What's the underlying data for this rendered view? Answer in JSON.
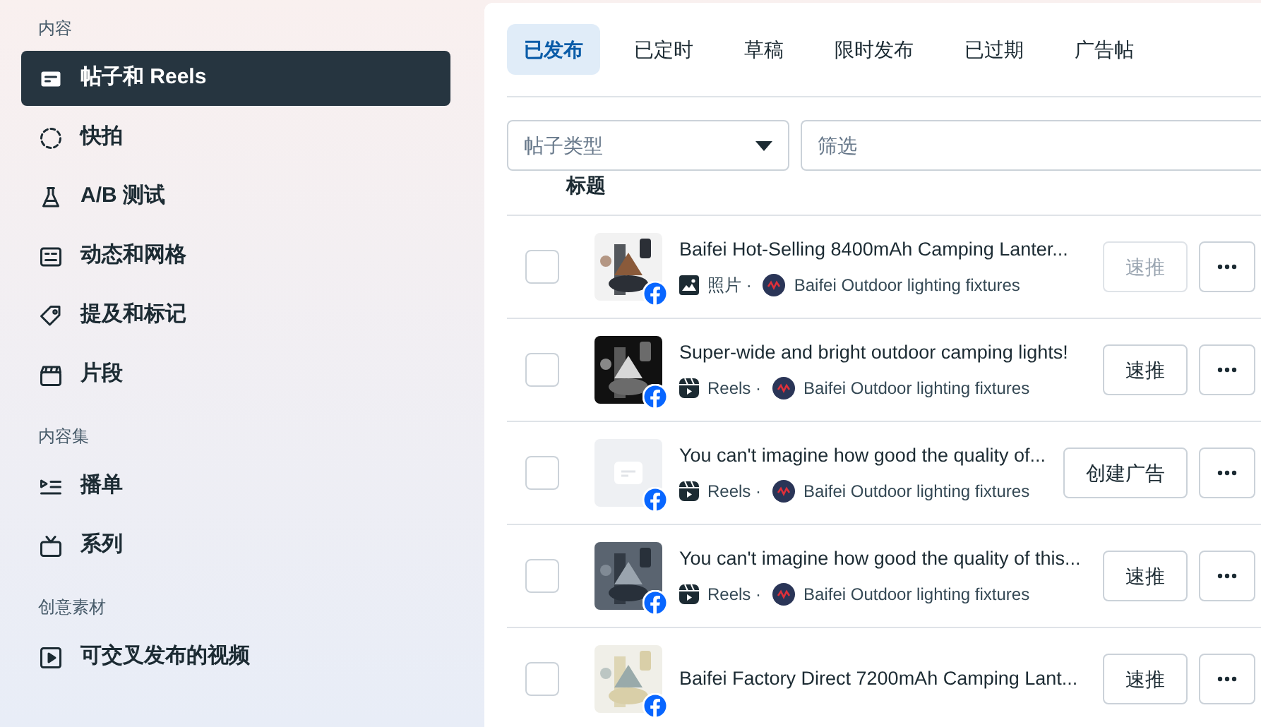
{
  "sidebar": {
    "sections": [
      {
        "title": "内容",
        "items": [
          {
            "label": "帖子和 Reels",
            "selected": true
          },
          {
            "label": "快拍",
            "selected": false
          },
          {
            "label": "A/B 测试",
            "selected": false
          },
          {
            "label": "动态和网格",
            "selected": false
          },
          {
            "label": "提及和标记",
            "selected": false
          },
          {
            "label": "片段",
            "selected": false
          }
        ]
      },
      {
        "title": "内容集",
        "items": [
          {
            "label": "播单",
            "selected": false
          },
          {
            "label": "系列",
            "selected": false
          }
        ]
      },
      {
        "title": "创意素材",
        "items": [
          {
            "label": "可交叉发布的视频",
            "selected": false
          }
        ]
      }
    ]
  },
  "tabs": [
    {
      "label": "已发布",
      "selected": true
    },
    {
      "label": "已定时",
      "selected": false
    },
    {
      "label": "草稿",
      "selected": false
    },
    {
      "label": "限时发布",
      "selected": false
    },
    {
      "label": "已过期",
      "selected": false
    },
    {
      "label": "广告帖",
      "selected": false
    }
  ],
  "filters": {
    "post_type": {
      "placeholder": "帖子类型"
    },
    "search": {
      "placeholder": "筛选"
    }
  },
  "table": {
    "columns": [
      "标题"
    ],
    "rows": [
      {
        "title": "Baifei Hot-Selling 8400mAh Camping Lanter...",
        "checked": false,
        "type": "照片 ·",
        "page": "Baifei Outdoor lighting fixtures",
        "action": "速推",
        "disabled": true
      },
      {
        "title": "Super-wide and bright outdoor camping lights!",
        "checked": false,
        "kind": "reels",
        "type": "Reels ·",
        "page": "Baifei Outdoor lighting fixtures",
        "action": "速推",
        "disabled": false
      },
      {
        "title": "You can't imagine how good the quality of...",
        "checked": false,
        "thumbnail": {
          "kind": "placeholder"
        },
        "kind": "reels",
        "type": "Reels ·",
        "page": "Baifei Outdoor lighting fixtures",
        "action": "创建广告",
        "disabled": false
      },
      {
        "title": "You can't imagine how good the quality of this...",
        "checked": false,
        "kind": "reels",
        "type": "Reels ·",
        "page": "Baifei Outdoor lighting fixtures",
        "action": "速推",
        "disabled": false
      },
      {
        "title": "Baifei Factory Direct 7200mAh Camping Lant...",
        "checked": false,
        "action": "速推",
        "disabled": false
      }
    ]
  }
}
